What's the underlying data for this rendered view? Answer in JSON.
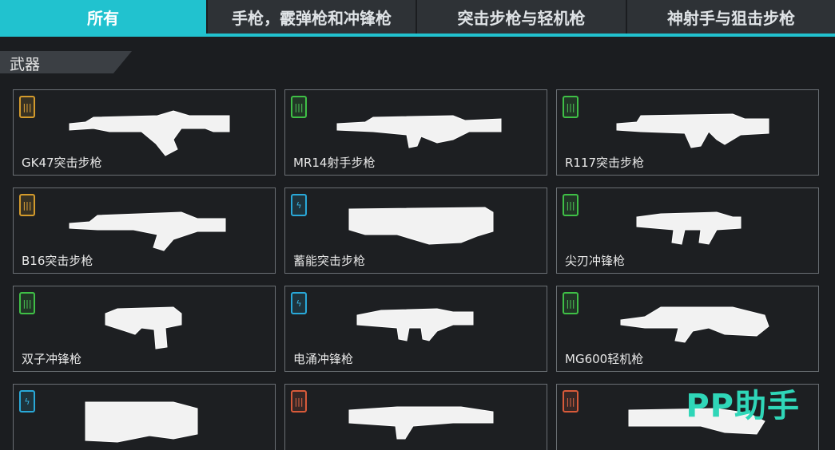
{
  "tabs": [
    {
      "label": "所有",
      "active": true
    },
    {
      "label": "手枪，霰弹枪和冲锋枪",
      "active": false
    },
    {
      "label": "突击步枪与轻机枪",
      "active": false
    },
    {
      "label": "神射手与狙击步枪",
      "active": false
    }
  ],
  "section": {
    "title": "武器"
  },
  "weapons": [
    {
      "name": "GK47突击步枪",
      "badge": "gold",
      "badge_icon": "ammo-icon"
    },
    {
      "name": "MR14射手步枪",
      "badge": "green",
      "badge_icon": "ammo-icon"
    },
    {
      "name": "R117突击步枪",
      "badge": "green",
      "badge_icon": "ammo-icon"
    },
    {
      "name": "B16突击步枪",
      "badge": "gold",
      "badge_icon": "ammo-icon"
    },
    {
      "name": "蓄能突击步枪",
      "badge": "blue",
      "badge_icon": "energy-icon"
    },
    {
      "name": "尖刃冲锋枪",
      "badge": "green",
      "badge_icon": "ammo-icon"
    },
    {
      "name": "双子冲锋枪",
      "badge": "green",
      "badge_icon": "ammo-icon"
    },
    {
      "name": "电涌冲锋枪",
      "badge": "blue",
      "badge_icon": "energy-icon"
    },
    {
      "name": "MG600轻机枪",
      "badge": "green",
      "badge_icon": "ammo-icon"
    },
    {
      "name": "",
      "badge": "blue",
      "badge_icon": "energy-icon"
    },
    {
      "name": "",
      "badge": "red",
      "badge_icon": "ammo-icon"
    },
    {
      "name": "",
      "badge": "red",
      "badge_icon": "ammo-icon"
    }
  ],
  "watermark": "PP助手",
  "colors": {
    "accent": "#21c2cf",
    "gold": "#d39a2c",
    "green": "#3fbf46",
    "blue": "#29a8d8",
    "red": "#d85a3a"
  }
}
